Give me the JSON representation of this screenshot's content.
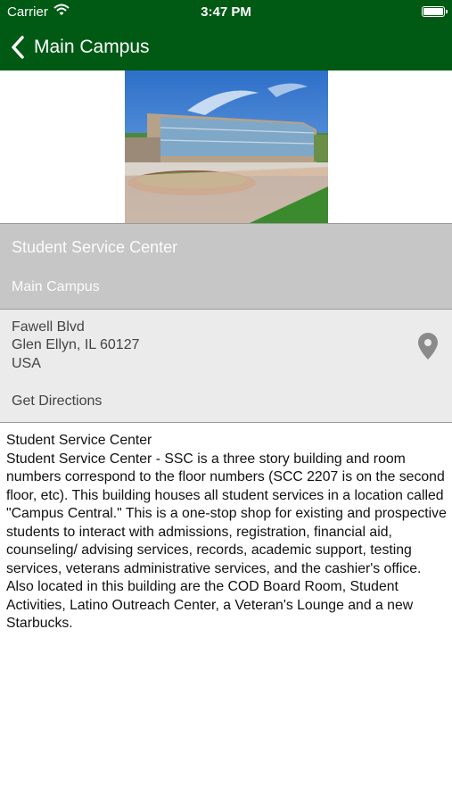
{
  "status_bar": {
    "carrier": "Carrier",
    "time": "3:47 PM"
  },
  "nav": {
    "back_label": "Main Campus",
    "bar_color": "#005a14"
  },
  "building": {
    "name": "Student Service Center",
    "campus": "Main Campus"
  },
  "address": {
    "street": "Fawell Blvd",
    "city_line": "Glen Ellyn, IL  60127",
    "country": "USA",
    "directions_label": "Get Directions",
    "pin_icon": "map-pin-icon"
  },
  "description": {
    "title": "Student Service Center",
    "body": "Student Service Center - SSC is a three story building and room numbers correspond to the floor numbers (SCC 2207 is on the second floor, etc). This building houses all student services in a location called \"Campus Central.\" This is a one-stop shop for existing and prospective students to interact with admissions, registration, financial aid, counseling/ advising services, records, academic support, testing services, veterans administrative services, and the cashier's office. Also located in this building are the COD Board Room, Student Activities, Latino Outreach Center, a Veteran's Lounge and a new Starbucks."
  }
}
